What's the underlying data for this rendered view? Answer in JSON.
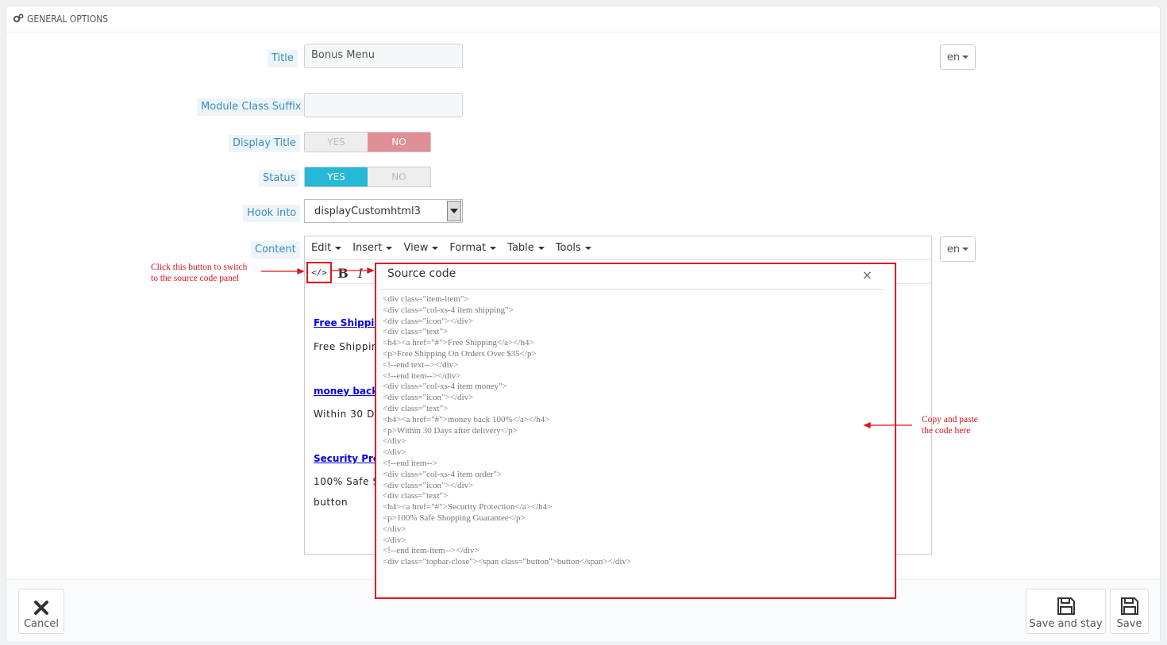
{
  "panel": {
    "heading": "GENERAL OPTIONS",
    "heading_icon": "cogs-icon"
  },
  "form": {
    "title": {
      "label": "Title",
      "value": "Bonus Menu",
      "lang": "en"
    },
    "module_class_suffix": {
      "label": "Module Class Suffix",
      "value": ""
    },
    "display_title": {
      "label": "Display Title",
      "yes": "YES",
      "no": "NO",
      "selected": "NO"
    },
    "status": {
      "label": "Status",
      "yes": "YES",
      "no": "NO",
      "selected": "YES"
    },
    "hook_into": {
      "label": "Hook into",
      "value": "displayCustomhtml3"
    },
    "content": {
      "label": "Content",
      "lang": "en"
    }
  },
  "editor": {
    "menu": [
      "Edit",
      "Insert",
      "View",
      "Format",
      "Table",
      "Tools"
    ],
    "toolbar": {
      "source_code": "</>",
      "bold": "B",
      "italic": "I"
    },
    "body": {
      "link1": "Free Shippin",
      "text1": "Free Shippin",
      "link2": "money back",
      "text2": "Within 30 Da",
      "link3": "Security Pro",
      "text3": "100% Safe S",
      "text4": "button"
    }
  },
  "dialog": {
    "title": "Source code",
    "close": "×",
    "code": [
      "<div class=\"item-item\">",
      "<div class=\"col-xs-4 item shipping\">",
      "<div class=\"icon\"></div>",
      "<div class=\"text\">",
      "<h4><a href=\"#\">Free Shipping</a></h4>",
      "<p>Free Shipping On Orders Over $35</p>",
      "<!--end text--></div>",
      "<!--end item--></div>",
      "<div class=\"col-xs-4 item money\">",
      "<div class=\"icon\"></div>",
      "<div class=\"text\">",
      "<h4><a href=\"#\">money back 100%</a></h4>",
      "<p>Within 30 Days after delivery</p>",
      "</div>",
      "</div>",
      "<!--end item-->",
      "<div class=\"col-xs-4 item order\">",
      "<div class=\"icon\"></div>",
      "<div class=\"text\">",
      "<h4><a href=\"#\">Security Protection</a></h4>",
      "<p>100% Safe Shopping Guarantee</p>",
      "</div>",
      "</div>",
      "<!--end item-item--></div>",
      "<div class=\"topbar-close\"><span class=\"button\">button</span></div>"
    ]
  },
  "annotations": {
    "switch_hint_line1": "Click this button to switch",
    "switch_hint_line2": "to the source code panel",
    "paste_hint_line1": "Copy and paste",
    "paste_hint_line2": "the code here",
    "color": "#e0141e"
  },
  "footer": {
    "cancel": "Cancel",
    "save_and_stay": "Save and stay",
    "save": "Save"
  },
  "colors": {
    "accent": "#25b9d7",
    "no_active": "#e08f95",
    "label_text": "#3b8cc0"
  }
}
